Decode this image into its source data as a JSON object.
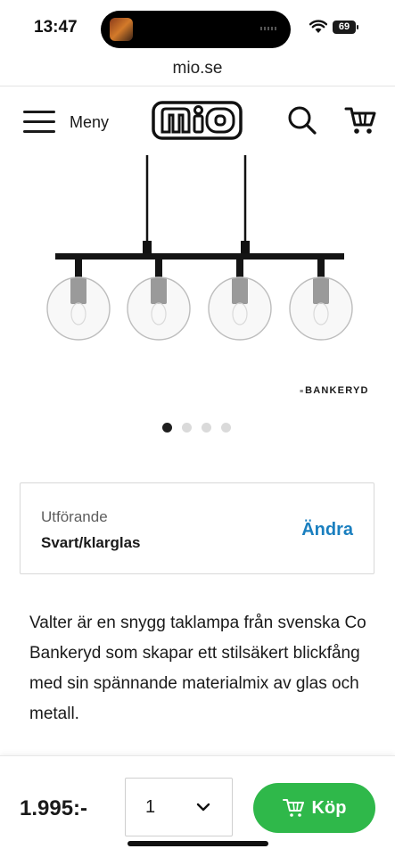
{
  "status_bar": {
    "time": "13:47",
    "battery": "69"
  },
  "browser": {
    "url": "mio.se"
  },
  "header": {
    "menu_label": "Meny",
    "logo_text": "MIO"
  },
  "product": {
    "brand": "BANKERYD",
    "image_count": 4,
    "active_image": 1,
    "variant": {
      "label": "Utförande",
      "value": "Svart/klarglas",
      "change_label": "Ändra"
    },
    "description": "Valter är en snygg taklampa från svenska Co Bankeryd som skapar ett stilsäkert blickfång med sin spännande materialmix av glas och metall."
  },
  "purchase": {
    "price": "1.995:-",
    "quantity": "1",
    "buy_label": "Köp"
  },
  "colors": {
    "buy_button": "#2fb84a",
    "link": "#1a7fbf",
    "text": "#1a1a1a"
  },
  "icons": [
    "wifi-icon",
    "battery-icon",
    "hamburger-icon",
    "search-icon",
    "cart-icon",
    "chevron-down-icon"
  ]
}
